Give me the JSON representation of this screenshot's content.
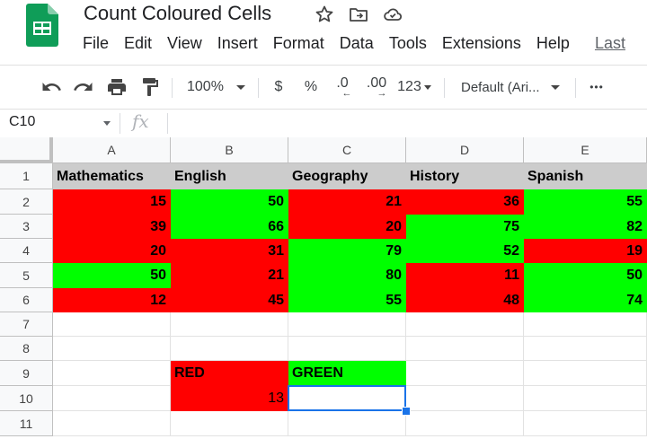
{
  "doc": {
    "title": "Count Coloured Cells"
  },
  "menu": {
    "items": [
      "File",
      "Edit",
      "View",
      "Insert",
      "Format",
      "Data",
      "Tools",
      "Extensions",
      "Help"
    ],
    "last_edit": "Last"
  },
  "toolbar": {
    "zoom": "100%",
    "currency": "$",
    "percent": "%",
    "decrease_decimals": ".0",
    "increase_decimals": ".00",
    "number_format": "123",
    "font": "Default (Ari...",
    "more": "•••"
  },
  "formula_bar": {
    "name_box": "C10",
    "fx": "fx",
    "formula": ""
  },
  "columns": [
    "A",
    "B",
    "C",
    "D",
    "E"
  ],
  "rows": [
    "1",
    "2",
    "3",
    "4",
    "5",
    "6",
    "7",
    "8",
    "9",
    "10",
    "11"
  ],
  "colors": {
    "red": "#ff0000",
    "green": "#00ff00",
    "header_fill": "#cccccc",
    "selection": "#1a73e8"
  },
  "headers": [
    "Mathematics",
    "English",
    "Geography",
    "History",
    "Spanish"
  ],
  "scores": [
    [
      15,
      50,
      21,
      36,
      55
    ],
    [
      39,
      66,
      20,
      75,
      82
    ],
    [
      20,
      31,
      79,
      52,
      19
    ],
    [
      50,
      21,
      80,
      11,
      50
    ],
    [
      12,
      45,
      55,
      48,
      74
    ]
  ],
  "score_colors": [
    [
      "red",
      "green",
      "red",
      "red",
      "green"
    ],
    [
      "red",
      "green",
      "red",
      "green",
      "green"
    ],
    [
      "red",
      "red",
      "green",
      "green",
      "red"
    ],
    [
      "green",
      "red",
      "green",
      "red",
      "green"
    ],
    [
      "red",
      "red",
      "green",
      "red",
      "green"
    ]
  ],
  "summary": {
    "red_label": "RED",
    "green_label": "GREEN",
    "red_count": "13",
    "green_count": ""
  },
  "selected_cell": "C10"
}
